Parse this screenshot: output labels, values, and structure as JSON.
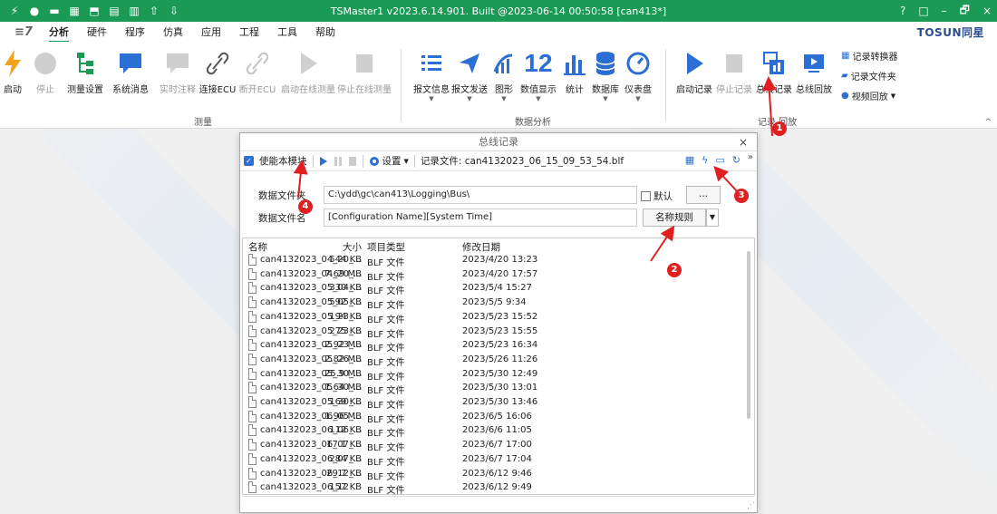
{
  "window": {
    "title": "TSMaster1 v2023.6.14.901. Built @2023-06-14 00:50:58 [can413*]",
    "controls": [
      "?",
      "□",
      "–",
      "🗗",
      "×"
    ]
  },
  "menu": {
    "items": [
      "分析",
      "硬件",
      "程序",
      "仿真",
      "应用",
      "工程",
      "工具",
      "帮助"
    ],
    "brand": "TOSUN同星"
  },
  "ribbon": {
    "measure_group": {
      "label": "测量",
      "buttons": [
        "启动",
        "停止",
        "测量设置",
        "系统消息",
        "实时注释",
        "连接ECU",
        "断开ECU",
        "启动在线测量",
        "停止在线测量"
      ]
    },
    "analysis_group": {
      "label": "数据分析",
      "buttons": [
        "报文信息",
        "报文发送",
        "图形",
        "数值显示",
        "统计",
        "数据库",
        "仪表盘"
      ],
      "numeric_glyph": "12"
    },
    "record_group": {
      "label": "记录 回放",
      "buttons": [
        "启动记录",
        "停止记录",
        "总线记录",
        "总线回放"
      ],
      "small_buttons": [
        "记录转换器",
        "记录文件夹",
        "视频回放"
      ]
    }
  },
  "dialog": {
    "title": "总线记录",
    "toolbar": {
      "enable_label": "使能本模块",
      "settings_label": "设置",
      "record_file_label": "记录文件: can4132023_06_15_09_53_54.blf"
    },
    "folder": {
      "label": "数据文件夹",
      "value": "C:\\ydd\\gc\\can413\\Logging\\Bus\\",
      "default_label": "默认",
      "browse_label": "..."
    },
    "filename": {
      "label": "数据文件名",
      "value": "[Configuration Name][System Time]",
      "rule_button": "名称规则"
    },
    "list": {
      "headers": {
        "name": "名称",
        "size": "大小",
        "type": "项目类型",
        "date": "修改日期"
      },
      "rows": [
        {
          "name": "can4132023_04_20_...",
          "size": "544 KB",
          "type": "BLF 文件",
          "date": "2023/4/20 13:23"
        },
        {
          "name": "can4132023_04_20_...",
          "size": "7.69 MB",
          "type": "BLF 文件",
          "date": "2023/4/20 17:57"
        },
        {
          "name": "can4132023_05_04_...",
          "size": "330 KB",
          "type": "BLF 文件",
          "date": "2023/5/4 15:27"
        },
        {
          "name": "can4132023_05_05_...",
          "size": "592 KB",
          "type": "BLF 文件",
          "date": "2023/5/5 9:34"
        },
        {
          "name": "can4132023_05_23_...",
          "size": "194 KB",
          "type": "BLF 文件",
          "date": "2023/5/23 15:52"
        },
        {
          "name": "can4132023_05_23_...",
          "size": "275 KB",
          "type": "BLF 文件",
          "date": "2023/5/23 15:55"
        },
        {
          "name": "can4132023_05_23_...",
          "size": "2.92 MB",
          "type": "BLF 文件",
          "date": "2023/5/23 16:34"
        },
        {
          "name": "can4132023_05_26_...",
          "size": "2.82 MB",
          "type": "BLF 文件",
          "date": "2023/5/26 11:26"
        },
        {
          "name": "can4132023_05_30_...",
          "size": "25.9 MB",
          "type": "BLF 文件",
          "date": "2023/5/30 12:49"
        },
        {
          "name": "can4132023_05_30_...",
          "size": "1.64 MB",
          "type": "BLF 文件",
          "date": "2023/5/30 13:01"
        },
        {
          "name": "can4132023_05_30_...",
          "size": "169 KB",
          "type": "BLF 文件",
          "date": "2023/5/30 13:46"
        },
        {
          "name": "can4132023_06_05_...",
          "size": "1.96 MB",
          "type": "BLF 文件",
          "date": "2023/6/5 16:06"
        },
        {
          "name": "can4132023_06_06_...",
          "size": "112 KB",
          "type": "BLF 文件",
          "date": "2023/6/6 11:05"
        },
        {
          "name": "can4132023_06_07_...",
          "size": "17.1 KB",
          "type": "BLF 文件",
          "date": "2023/6/7 17:00"
        },
        {
          "name": "can4132023_06_07_...",
          "size": "284 KB",
          "type": "BLF 文件",
          "date": "2023/6/7 17:04"
        },
        {
          "name": "can4132023_06_12_...",
          "size": "29.7 KB",
          "type": "BLF 文件",
          "date": "2023/6/12 9:46"
        },
        {
          "name": "can4132023_06_12",
          "size": "157 KB",
          "type": "BLF 文件",
          "date": "2023/6/12 9:49"
        }
      ]
    }
  },
  "annotations": [
    "1",
    "2",
    "3",
    "4"
  ],
  "colors": {
    "titlebar": "#1a9a55",
    "accent_blue": "#2b6fd6",
    "annotation_red": "#e02020"
  }
}
